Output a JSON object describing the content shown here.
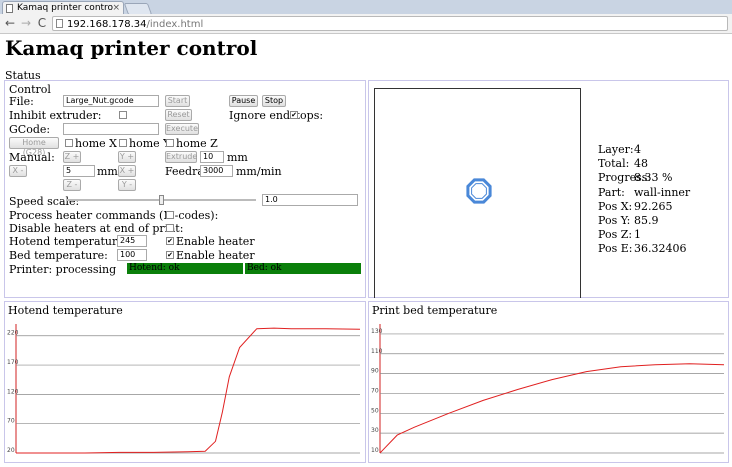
{
  "browser": {
    "tab_title": "Kamaq printer contro",
    "close_glyph": "×",
    "back_glyph": "←",
    "forward_glyph": "→",
    "reload_glyph": "C",
    "url_host": "192.168.178.34",
    "url_path": "/index.html"
  },
  "page": {
    "title": "Kamaq printer control",
    "status_label": "Status"
  },
  "control": {
    "title": "Control",
    "file_label": "File:",
    "file_value": "Large_Nut.gcode",
    "start_label": "Start",
    "pause_label": "Pause",
    "stop_label": "Stop",
    "inhibit_label": "Inhibit extruder:",
    "inhibit_checked": false,
    "reset_label": "Reset",
    "ignore_label": "Ignore endstops:",
    "ignore_checked": true,
    "gcode_label": "GCode:",
    "gcode_value": "",
    "execute_label": "Execute",
    "home_g28_label": "Home (G28)",
    "home_x_label": "home X",
    "home_y_label": "home Y",
    "home_z_label": "home Z",
    "manual_label": "Manual:",
    "z_plus_label": "Z +",
    "y_plus_label": "Y +",
    "extrude_label": "Extrude",
    "extrude_value": "10",
    "extrude_unit": "mm",
    "x_minus_label": "X -",
    "step_value": "5",
    "step_unit": "mm",
    "x_plus_label": "X +",
    "feedrate_label": "Feedrate:",
    "feedrate_value": "3000",
    "feedrate_unit": "mm/min",
    "z_minus_label": "Z -",
    "y_minus_label": "Y -",
    "speed_label": "Speed scale:",
    "speed_value": "1.0",
    "speed_fraction": 0.5,
    "heater_cmds_label": "Process heater commands (M-codes):",
    "heater_cmds_checked": false,
    "disable_heaters_label": "Disable heaters at end of print:",
    "disable_heaters_checked": false,
    "hotend_label": "Hotend temperature:",
    "hotend_value": "245",
    "hotend_enable_label": "Enable heater",
    "hotend_enable_checked": true,
    "bed_label": "Bed temperature:",
    "bed_value": "100",
    "bed_enable_label": "Enable heater",
    "bed_enable_checked": true,
    "printer_status": "Printer: processing",
    "hotend_status": "Hotend: ok",
    "bed_status": "Bed: ok",
    "ok_color": "#0a7f0a"
  },
  "print_info": {
    "rows": [
      {
        "label": "Layer:",
        "value": "4"
      },
      {
        "label": "Total:",
        "value": "48"
      },
      {
        "label": "Progress:",
        "value": "8.33 %"
      },
      {
        "label": "Part:",
        "value": "wall-inner"
      },
      {
        "label": "Pos X:",
        "value": "92.265"
      },
      {
        "label": "Pos Y:",
        "value": "85.9"
      },
      {
        "label": "Pos Z:",
        "value": "1"
      },
      {
        "label": "Pos E:",
        "value": "36.32406"
      }
    ],
    "preview_color": "#4a88d8"
  },
  "chart_data": [
    {
      "type": "line",
      "title": "Hotend temperature",
      "ylim": [
        20,
        240
      ],
      "yticks": [
        20,
        70,
        120,
        170,
        220
      ],
      "grid": true,
      "line_color": "#e02020",
      "x": [
        0,
        5,
        10,
        20,
        30,
        40,
        50,
        55,
        58,
        60,
        62,
        65,
        70,
        75,
        80,
        90,
        100
      ],
      "y": [
        20,
        20,
        20,
        20,
        21,
        21,
        22,
        23,
        40,
        90,
        150,
        200,
        232,
        233,
        232,
        232,
        231
      ]
    },
    {
      "type": "line",
      "title": "Print bed temperature",
      "ylim": [
        10,
        140
      ],
      "yticks": [
        10,
        30,
        50,
        70,
        90,
        110,
        130
      ],
      "grid": true,
      "line_color": "#e02020",
      "x": [
        0,
        5,
        10,
        20,
        30,
        40,
        50,
        60,
        70,
        80,
        90,
        100
      ],
      "y": [
        10,
        28,
        36,
        50,
        63,
        74,
        84,
        92,
        97,
        99,
        100,
        99
      ]
    }
  ]
}
